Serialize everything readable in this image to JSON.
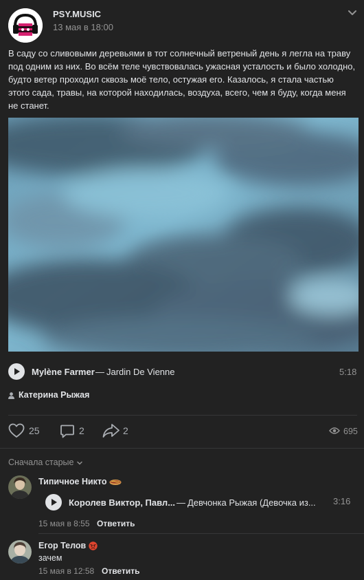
{
  "post": {
    "group_name": "PSY.MUSIC",
    "date": "13 мая в 18:00",
    "text": "В саду со сливовыми деревьями в тот солнечный ветреный день я легла на траву под одним из них. Во всём теле чувствовалась ужасная усталость и было холодно, будто ветер проходил сквозь моё тело, остужая его. Казалось, я стала частью этого сада, травы, на которой находилась, воздуха, всего, чем я буду, когда меня не станет.",
    "audio": {
      "artist": "Mylène Farmer",
      "separator": "—",
      "title": "Jardin De Vienne",
      "duration": "5:18"
    },
    "author": "Катерина Рыжая",
    "likes": "25",
    "comments": "2",
    "shares": "2",
    "views": "695"
  },
  "comments_section": {
    "sort_label": "Сначала старые",
    "items": [
      {
        "name": "Типичное Никто",
        "audio": {
          "artist": "Королев Виктор, Павл...",
          "separator": "—",
          "title": "Девчонка Рыжая (Девочка из...",
          "duration": "3:16"
        },
        "date": "15 мая в 8:55",
        "reply": "Ответить"
      },
      {
        "name": "Егор Телов",
        "text": "зачем",
        "date": "15 мая в 12:58",
        "reply": "Ответить"
      }
    ]
  },
  "colors": {
    "background": "#222222",
    "text": "#e1e3e6",
    "secondary": "#939393"
  }
}
